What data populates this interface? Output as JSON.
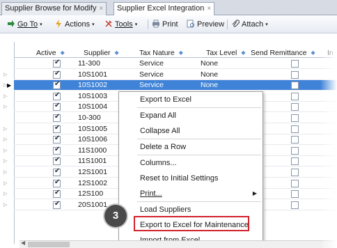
{
  "tabs": [
    {
      "label": "Supplier Browse for Modify",
      "close": "×"
    },
    {
      "label": "Supplier Excel Integration",
      "close": "×"
    }
  ],
  "toolbar": {
    "goto": "Go To",
    "actions": "Actions",
    "tools": "Tools",
    "print": "Print",
    "preview": "Preview",
    "attach": "Attach",
    "dropdown": "▾"
  },
  "grid": {
    "headers": [
      "Active",
      "Supplier",
      "Tax Nature",
      "Tax Level",
      "Send Remittance",
      "In"
    ],
    "rows": [
      {
        "supplier": "11-300",
        "tax_nature": "Service",
        "tax_level": "None",
        "active": true,
        "remit": false
      },
      {
        "supplier": "10S1001",
        "tax_nature": "Service",
        "tax_level": "None",
        "active": true,
        "remit": false
      },
      {
        "supplier": "10S1002",
        "tax_nature": "Service",
        "tax_level": "None",
        "active": true,
        "remit": false,
        "selected": true
      },
      {
        "supplier": "10S1003",
        "tax_nature": "",
        "tax_level": "",
        "active": true,
        "remit": false
      },
      {
        "supplier": "10S1004",
        "tax_nature": "",
        "tax_level": "",
        "active": true,
        "remit": false
      },
      {
        "supplier": "10-300",
        "tax_nature": "",
        "tax_level": "",
        "active": true,
        "remit": false
      },
      {
        "supplier": "10S1005",
        "tax_nature": "",
        "tax_level": "",
        "active": true,
        "remit": false
      },
      {
        "supplier": "10S1006",
        "tax_nature": "",
        "tax_level": "",
        "active": true,
        "remit": false
      },
      {
        "supplier": "11S1000",
        "tax_nature": "",
        "tax_level": "",
        "active": true,
        "remit": false
      },
      {
        "supplier": "11S1001",
        "tax_nature": "",
        "tax_level": "",
        "active": true,
        "remit": false
      },
      {
        "supplier": "12S1001",
        "tax_nature": "",
        "tax_level": "",
        "active": true,
        "remit": false
      },
      {
        "supplier": "12S1002",
        "tax_nature": "",
        "tax_level": "",
        "active": true,
        "remit": false
      },
      {
        "supplier": "12S100",
        "tax_nature": "",
        "tax_level": "",
        "active": true,
        "remit": false
      },
      {
        "supplier": "20S1001",
        "tax_nature": "",
        "tax_level": "",
        "active": true,
        "remit": false
      }
    ]
  },
  "context_menu": {
    "items": [
      "Export to Excel",
      "Expand All",
      "Collapse All",
      "Delete a Row",
      "Columns...",
      "Reset to Initial Settings",
      "Print...",
      "Load Suppliers",
      "Export to Excel for Maintenance",
      "Import from Excel"
    ],
    "highlighted": "Export to Excel for Maintenance"
  },
  "callout": "3",
  "colors": {
    "selection": "#3f83d8",
    "highlight_border": "#d3202a",
    "callout_bg": "#4a4a4a"
  }
}
